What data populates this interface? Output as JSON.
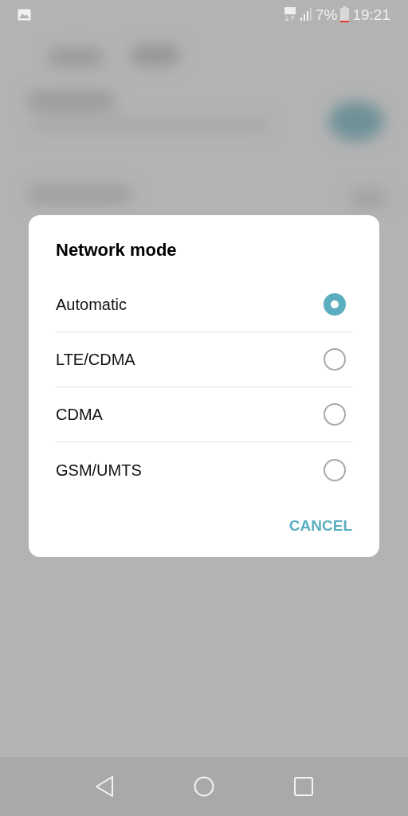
{
  "status_bar": {
    "battery": "7%",
    "time": "19:21"
  },
  "dialog": {
    "title": "Network mode",
    "options": [
      {
        "label": "Automatic",
        "selected": true
      },
      {
        "label": "LTE/CDMA",
        "selected": false
      },
      {
        "label": "CDMA",
        "selected": false
      },
      {
        "label": "GSM/UMTS",
        "selected": false
      }
    ],
    "button": "CANCEL"
  }
}
